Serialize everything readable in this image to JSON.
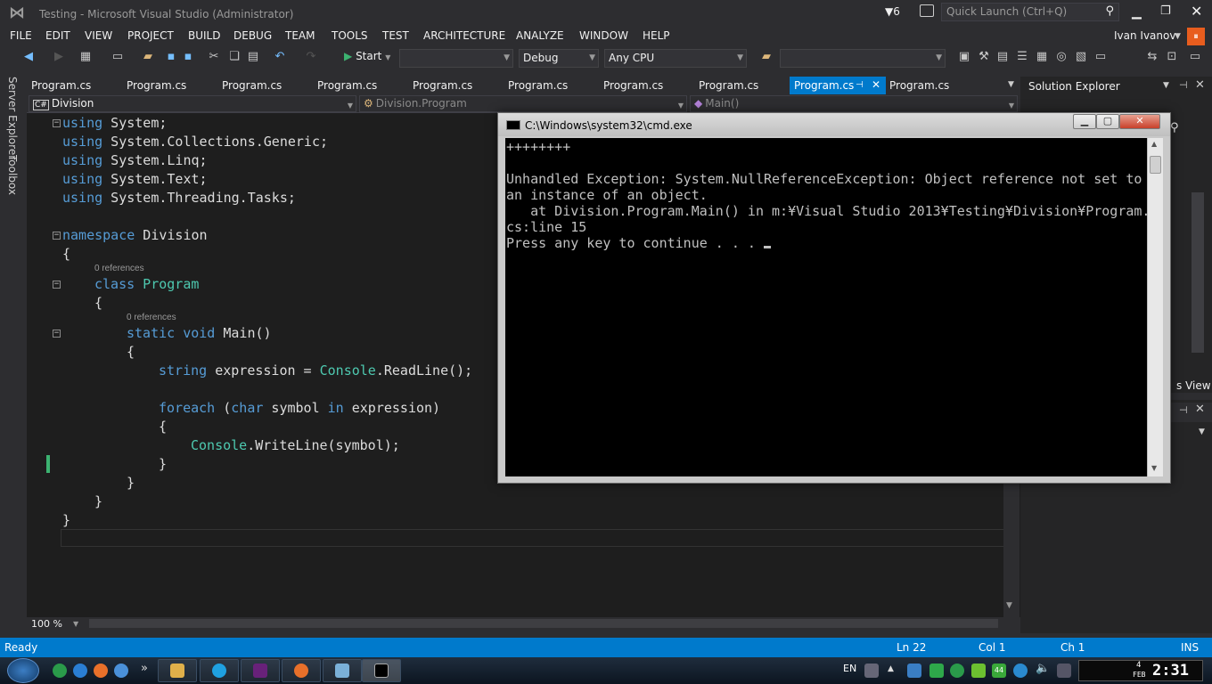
{
  "window": {
    "title": "Testing - Microsoft Visual Studio (Administrator)",
    "notif_count": "6",
    "quick_launch_placeholder": "Quick Launch (Ctrl+Q)",
    "user": "Ivan Ivanov"
  },
  "menu": [
    "FILE",
    "EDIT",
    "VIEW",
    "PROJECT",
    "BUILD",
    "DEBUG",
    "TEAM",
    "TOOLS",
    "TEST",
    "ARCHITECTURE",
    "ANALYZE",
    "WINDOW",
    "HELP"
  ],
  "toolbar": {
    "start_label": "Start",
    "config": "Debug",
    "platform": "Any CPU"
  },
  "side_tabs": {
    "server_explorer": "Server Explorer",
    "toolbox": "Toolbox"
  },
  "tabs": [
    "Program.cs",
    "Program.cs",
    "Program.cs",
    "Program.cs",
    "Program.cs",
    "Program.cs",
    "Program.cs",
    "Program.cs",
    "Program.cs",
    "Program.cs"
  ],
  "nav": {
    "project": "Division",
    "class": "Division.Program",
    "member": "Main()"
  },
  "code": {
    "l1": [
      "using",
      " System;"
    ],
    "l2": [
      "using",
      " System.Collections.Generic;"
    ],
    "l3": [
      "using",
      " System.Linq;"
    ],
    "l4": [
      "using",
      " System.Text;"
    ],
    "l5": [
      "using",
      " System.Threading.Tasks;"
    ],
    "ns_kw": "namespace",
    "ns_name": " Division",
    "brace_open": "{",
    "brace_close": "}",
    "refs1": "0 references",
    "class_kw": "class",
    "class_name": " Program",
    "refs2": "0 references",
    "static_void": "static void",
    "main": " Main()",
    "string_kw": "string",
    "expr": " expression = ",
    "console": "Console",
    "readline": ".ReadLine();",
    "foreach_kw": "foreach",
    "paren_open": " (",
    "char_kw": "char",
    "symbol": " symbol ",
    "in_kw": "in",
    "expr_close": " expression)",
    "writeline": ".WriteLine(symbol);"
  },
  "zoom": "100 %",
  "solution_explorer": {
    "title": "Solution Explorer",
    "partial_label": "s View"
  },
  "cmd": {
    "title": "C:\\Windows\\system32\\cmd.exe",
    "lines": [
      "++++++++",
      "",
      "Unhandled Exception: System.NullReferenceException: Object reference not set to",
      "an instance of an object.",
      "   at Division.Program.Main() in m:¥Visual Studio 2013¥Testing¥Division¥Program.",
      "cs:line 15",
      "Press any key to continue . . . "
    ]
  },
  "status": {
    "ready": "Ready",
    "ln": "Ln 22",
    "col": "Col 1",
    "ch": "Ch 1",
    "ins": "INS"
  },
  "taskbar": {
    "lang": "EN",
    "day": "4",
    "month": "FEB",
    "time": "2:31",
    "badge": "44"
  }
}
